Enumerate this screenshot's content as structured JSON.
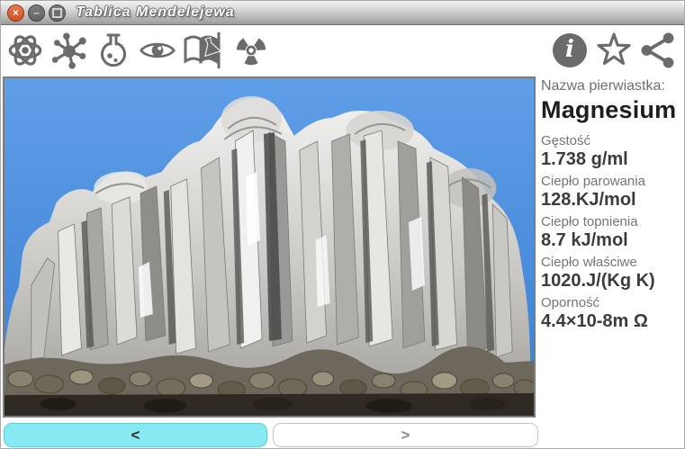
{
  "window": {
    "title": "Tablica Mendelejewa",
    "controls": {
      "close_glyph": "×",
      "minimize_glyph": "–",
      "icons": [
        "close",
        "minimize",
        "maximize"
      ]
    }
  },
  "toolbar": {
    "left_icons": [
      "atom",
      "molecule",
      "flask",
      "eye",
      "chemistry-book",
      "radiation"
    ],
    "right_icons": [
      "info",
      "favorite-star",
      "share"
    ],
    "info_glyph": "i"
  },
  "photo": {
    "description": "magnesium crystal sample on blue background"
  },
  "panel": {
    "name_label": "Nazwa pierwiastka:",
    "element_name": "Magnesium",
    "properties": [
      {
        "label": "Gęstość",
        "value": "1.738 g/ml"
      },
      {
        "label": "Ciepło parowania",
        "value": "128.KJ/mol"
      },
      {
        "label": "Ciepło topnienia",
        "value": "8.7 kJ/mol"
      },
      {
        "label": "Ciepło właściwe",
        "value": "1020.J/(Kg K)"
      },
      {
        "label": "Oporność",
        "value": "4.4×10-8m Ω"
      }
    ]
  },
  "nav": {
    "prev_label": "<",
    "next_label": ">"
  },
  "colors": {
    "accent_cyan": "#87e9f2",
    "sky_blue": "#4a90e0",
    "icon_gray": "#6b6b6b",
    "close_orange": "#d95a2e"
  }
}
